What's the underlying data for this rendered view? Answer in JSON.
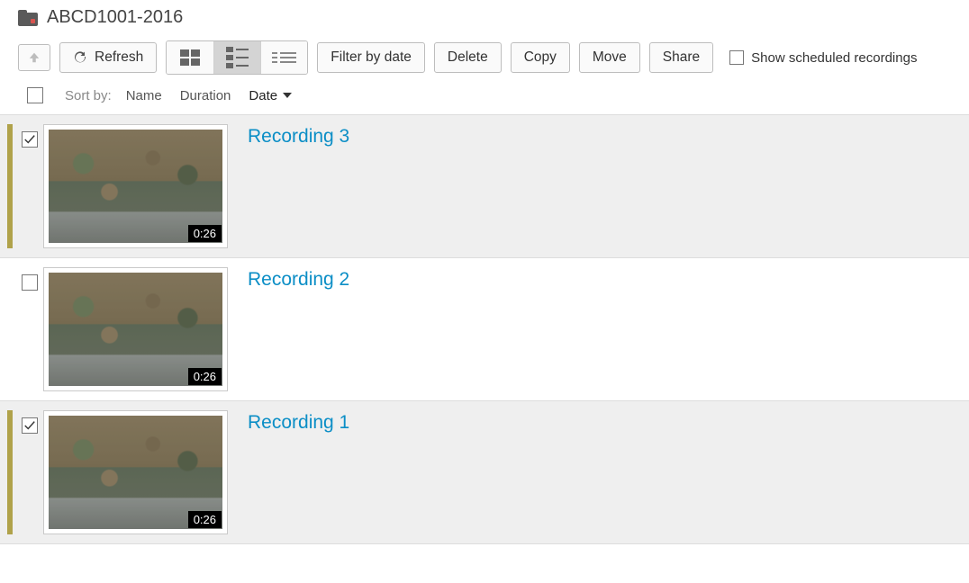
{
  "header": {
    "title": "ABCD1001-2016"
  },
  "toolbar": {
    "refresh": "Refresh",
    "filter": "Filter by date",
    "delete": "Delete",
    "copy": "Copy",
    "move": "Move",
    "share": "Share",
    "show_scheduled": "Show scheduled recordings"
  },
  "sort": {
    "label": "Sort by:",
    "name": "Name",
    "duration": "Duration",
    "date": "Date"
  },
  "recordings": [
    {
      "title": "Recording 3",
      "duration": "0:26",
      "selected": true
    },
    {
      "title": "Recording 2",
      "duration": "0:26",
      "selected": false
    },
    {
      "title": "Recording 1",
      "duration": "0:26",
      "selected": true
    }
  ]
}
